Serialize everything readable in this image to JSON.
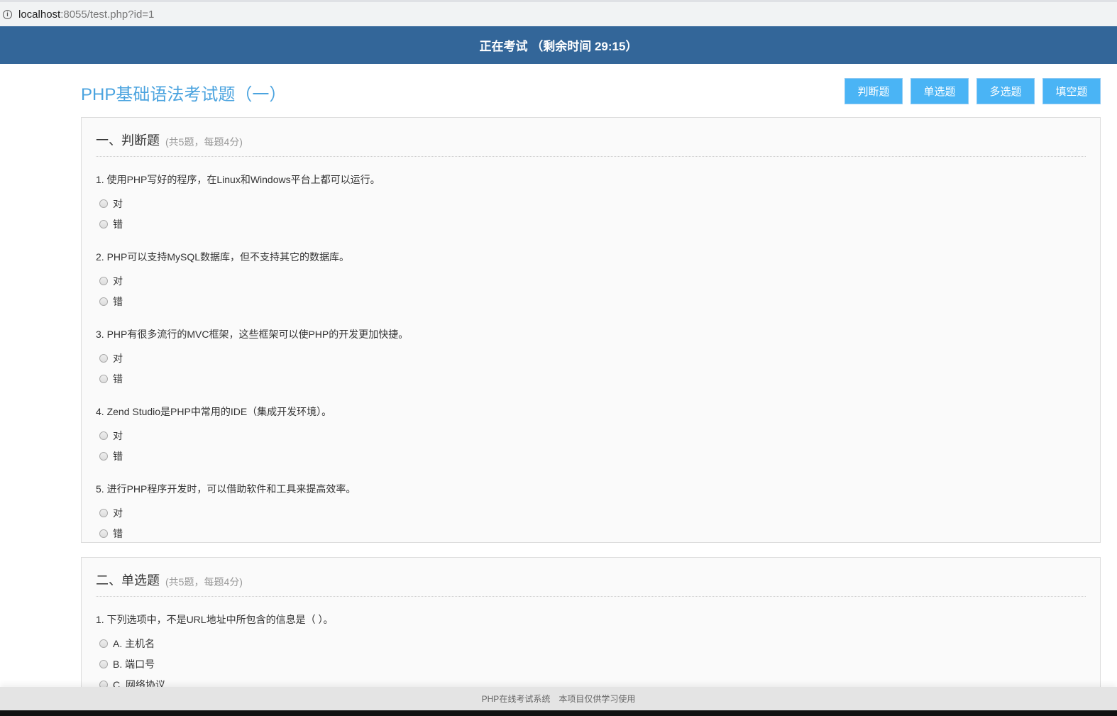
{
  "address": {
    "host": "localhost",
    "path": ":8055/test.php?id=1"
  },
  "header": {
    "status": "正在考试 （剩余时间 29:15）"
  },
  "page_title": "PHP基础语法考试题（一）",
  "nav_buttons": [
    "判断题",
    "单选题",
    "多选题",
    "填空题"
  ],
  "sections": [
    {
      "title": "一、判断题",
      "meta": "(共5题，每题4分)",
      "questions": [
        {
          "text": "1. 使用PHP写好的程序，在Linux和Windows平台上都可以运行。",
          "options": [
            "对",
            "错"
          ]
        },
        {
          "text": "2. PHP可以支持MySQL数据库，但不支持其它的数据库。",
          "options": [
            "对",
            "错"
          ]
        },
        {
          "text": "3. PHP有很多流行的MVC框架，这些框架可以使PHP的开发更加快捷。",
          "options": [
            "对",
            "错"
          ]
        },
        {
          "text": "4. Zend Studio是PHP中常用的IDE（集成开发环境）。",
          "options": [
            "对",
            "错"
          ]
        },
        {
          "text": "5. 进行PHP程序开发时，可以借助软件和工具来提高效率。",
          "options": [
            "对",
            "错"
          ]
        }
      ]
    },
    {
      "title": "二、单选题",
      "meta": "(共5题，每题4分)",
      "questions": [
        {
          "text": "1. 下列选项中，不是URL地址中所包含的信息是（ ）。",
          "options": [
            "A. 主机名",
            "B. 端口号",
            "C. 网络协议"
          ]
        }
      ]
    }
  ],
  "footer": {
    "left": "PHP在线考试系统",
    "right": "本项目仅供学习使用"
  }
}
